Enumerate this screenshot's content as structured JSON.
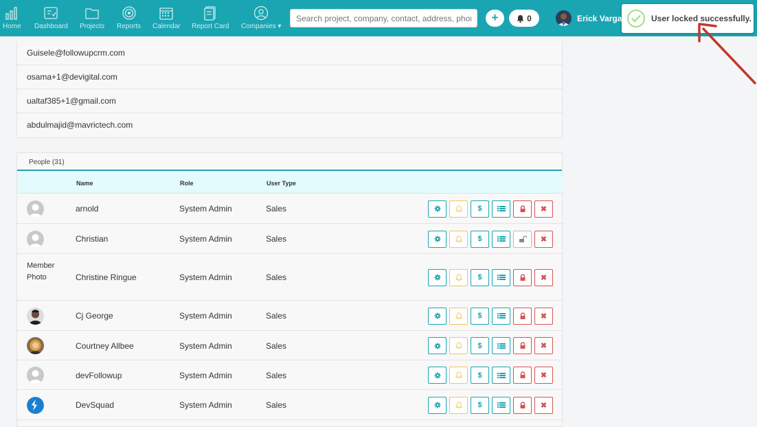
{
  "nav": {
    "items": [
      {
        "label": "Home",
        "icon": "home-chart-icon"
      },
      {
        "label": "Dashboard",
        "icon": "dashboard-icon"
      },
      {
        "label": "Projects",
        "icon": "folder-icon"
      },
      {
        "label": "Reports",
        "icon": "target-icon"
      },
      {
        "label": "Calendar",
        "icon": "calendar-icon"
      },
      {
        "label": "Report Card",
        "icon": "report-card-icon"
      },
      {
        "label": "Companies ▾",
        "icon": "companies-icon"
      }
    ],
    "search_placeholder": "Search project, company, contact, address, phone",
    "add_label": "+",
    "notification_count": "0",
    "user_name": "Erick Vargas"
  },
  "toast": {
    "message": "User locked successfully."
  },
  "emails": [
    "Guisele@followupcrm.com",
    "osama+1@devigital.com",
    "ualtaf385+1@gmail.com",
    "abdulmajid@mavrictech.com"
  ],
  "people": {
    "title": "People (31)",
    "columns": {
      "name": "Name",
      "role": "Role",
      "user_type": "User Type"
    },
    "rows": [
      {
        "name": "arnold",
        "role": "System Admin",
        "user_type": "Sales",
        "avatar": "default",
        "lock": "locked"
      },
      {
        "name": "Christian",
        "role": "System Admin",
        "user_type": "Sales",
        "avatar": "default",
        "lock": "unlocked"
      },
      {
        "name": "Christine Ringue",
        "role": "System Admin",
        "user_type": "Sales",
        "avatar": "broken",
        "avatar_alt": "Member Photo",
        "lock": "locked"
      },
      {
        "name": "Cj George",
        "role": "System Admin",
        "user_type": "Sales",
        "avatar": "photo-dark",
        "lock": "locked"
      },
      {
        "name": "Courtney Allbee",
        "role": "System Admin",
        "user_type": "Sales",
        "avatar": "photo-blonde",
        "lock": "locked"
      },
      {
        "name": "devFollowup",
        "role": "System Admin",
        "user_type": "Sales",
        "avatar": "default",
        "lock": "locked"
      },
      {
        "name": "DevSquad",
        "role": "System Admin",
        "user_type": "Sales",
        "avatar": "logo-blue",
        "lock": "locked"
      }
    ]
  },
  "action_buttons": {
    "settings": "gear-icon",
    "notify": "bell-icon",
    "billing": "$",
    "list": "list-icon",
    "lock": "lock-icon",
    "delete": "✖"
  },
  "colors": {
    "brand": "#1aa5b2",
    "warning": "#f2c45f",
    "danger": "#d9534f",
    "header_row": "#e4fbfd",
    "annotation": "#c0392b"
  }
}
